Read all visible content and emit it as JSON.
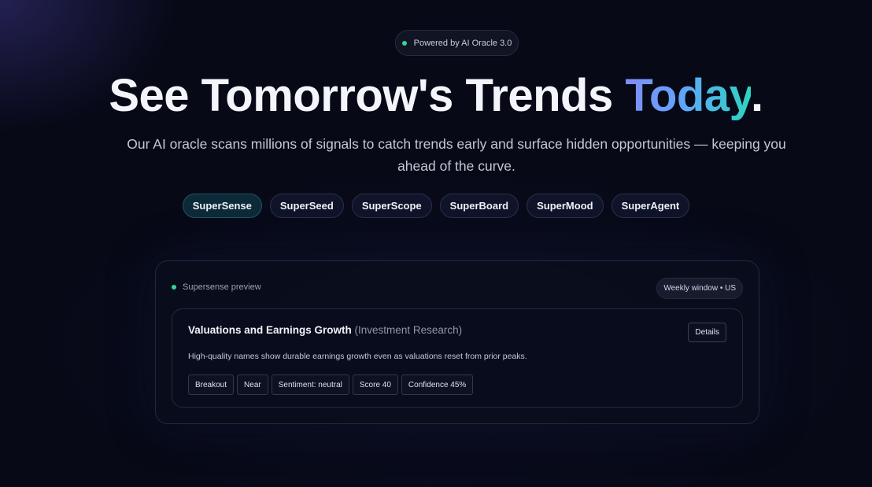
{
  "badge": {
    "text": "Powered by AI Oracle 3.0",
    "dot_color": "#38d39a"
  },
  "hero": {
    "title_main": "See Tomorrow's Trends ",
    "title_accent": "Today",
    "title_end": ".",
    "subtitle": "Our AI oracle scans millions of signals to catch trends early and surface hidden opportunities — keeping you ahead of the curve."
  },
  "products": [
    "SuperSense",
    "SuperSeed",
    "SuperScope",
    "SuperBoard",
    "SuperMood",
    "SuperAgent"
  ],
  "active_product": "SuperSense",
  "preview": {
    "label": "Supersense preview",
    "window": "Weekly window • US",
    "card": {
      "title": "Valuations and Earnings Growth",
      "category": "(Investment Research)",
      "details_label": "Details",
      "description": "High-quality names show durable earnings growth even as valuations reset from prior peaks.",
      "tags": [
        "Breakout",
        "Near",
        "Sentiment: neutral",
        "Score 40",
        "Confidence 45%"
      ]
    }
  },
  "colors": {
    "background": "#070917",
    "accent_gradient": [
      "#818cf8",
      "#60a5fa",
      "#2dd4bf"
    ],
    "status_green": "#38d39a"
  }
}
